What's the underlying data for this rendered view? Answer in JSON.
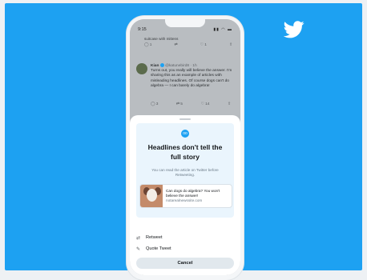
{
  "status": {
    "time": "9:15",
    "icons": "▮▮ ◠ ▬"
  },
  "previous_tweet": {
    "text": "suitcase with mittens",
    "actions": [
      "1",
      "",
      "1",
      ""
    ]
  },
  "tweet": {
    "name": "Kian",
    "handle": "@katunebird8 · 1h",
    "text": "Turns out, you really will believe the answer. I'm sharing this as an example of articles with misleading headlines. Of course dogs can't do algebra — I can barely do algebra!",
    "actions": [
      "3",
      "5",
      "14",
      ""
    ]
  },
  "sheet": {
    "headline": "Headlines don't tell the full story",
    "subtext": "You can read the article on Twitter before Retweeting.",
    "preview": {
      "title": "Can dogs do algebra? You won't believe the answer!",
      "url": "notarealnewssite.com"
    },
    "options": {
      "retweet": "Retweet",
      "quote_tweet": "Quote Tweet"
    },
    "cancel": "Cancel"
  },
  "colors": {
    "background": "#1da1f2",
    "accent": "#1da1f2",
    "card": "#eaf5fd"
  },
  "icons": {
    "brand": "twitter-bird-icon",
    "retweet": "retweet-icon",
    "quote": "pencil-icon",
    "info": "info-icon"
  }
}
